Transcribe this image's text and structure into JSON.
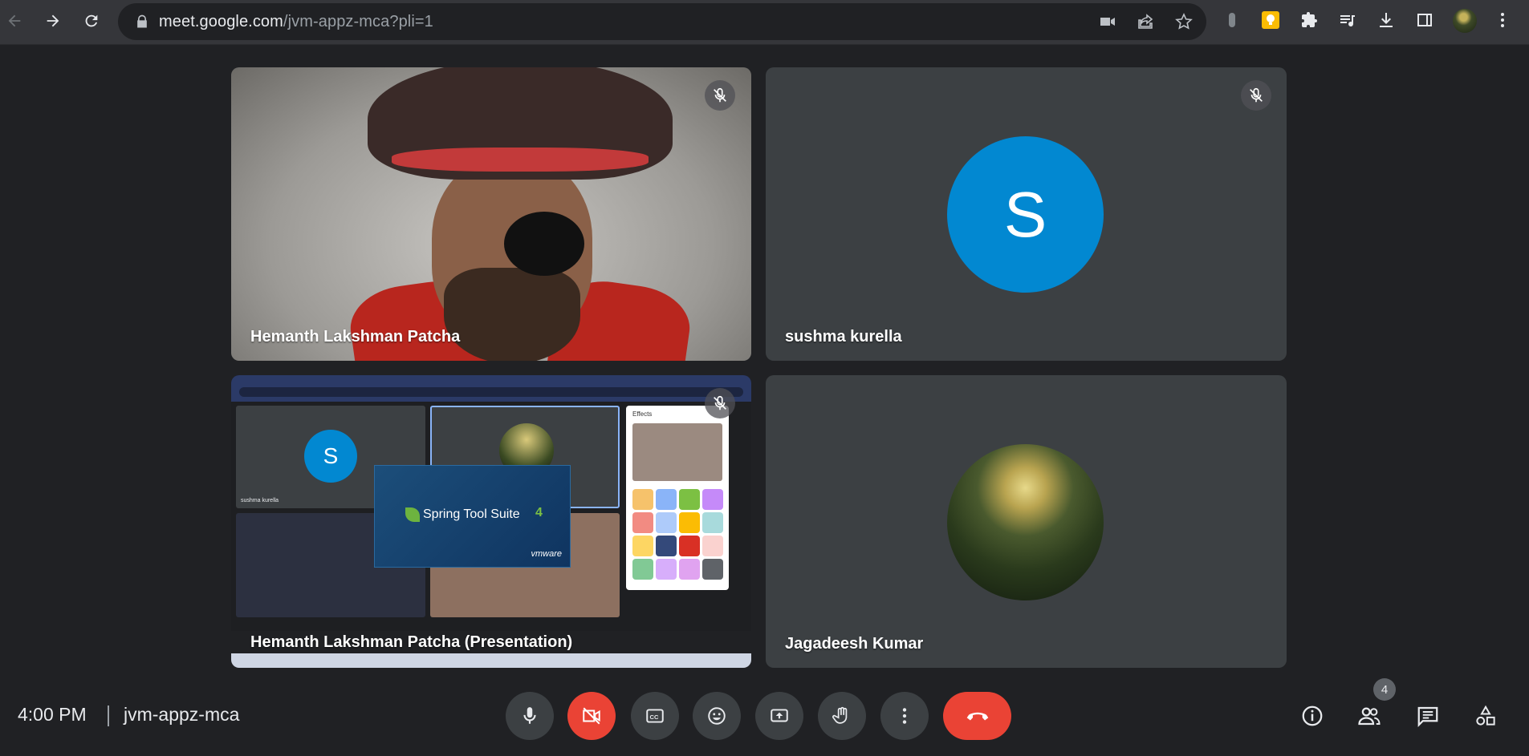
{
  "browser": {
    "url_host": "meet.google.com",
    "url_path": "/jvm-appz-mca?pli=1",
    "icons": [
      "back-icon",
      "forward-icon",
      "reload-icon",
      "lock-icon",
      "camera-icon",
      "share-icon",
      "star-icon",
      "extension-icon",
      "keep-icon",
      "puzzle-icon",
      "media-icon",
      "download-icon",
      "side-panel-icon",
      "profile-avatar",
      "menu-icon"
    ]
  },
  "tiles": [
    {
      "name": "Hemanth Lakshman Patcha",
      "muted": true,
      "type": "video"
    },
    {
      "name": "sushma kurella",
      "muted": true,
      "type": "avatar",
      "initial": "S",
      "avatar_color": "#0288d1"
    },
    {
      "name": "Hemanth Lakshman Patcha (Presentation)",
      "muted": true,
      "type": "presentation"
    },
    {
      "name": "Jagadeesh Kumar",
      "muted": false,
      "type": "avatar-image"
    }
  ],
  "presentation": {
    "mini_initial": "S",
    "mini_name": "sushma kurella",
    "splash_title": "Spring Tool Suite",
    "splash_version": "4",
    "splash_vendor": "vmware",
    "effects_title": "Effects"
  },
  "footer": {
    "time": "4:00 PM",
    "meeting_code": "jvm-appz-mca",
    "participant_count": "4",
    "controls": [
      "mic-button",
      "camera-off-button",
      "captions-button",
      "emoji-button",
      "present-button",
      "raise-hand-button",
      "more-options-button",
      "leave-call-button"
    ],
    "right_controls": [
      "info-button",
      "people-button",
      "chat-button",
      "activities-button"
    ]
  },
  "colors": {
    "background": "#202124",
    "tile": "#3c4043",
    "danger": "#ea4335",
    "avatar_blue": "#0288d1"
  }
}
